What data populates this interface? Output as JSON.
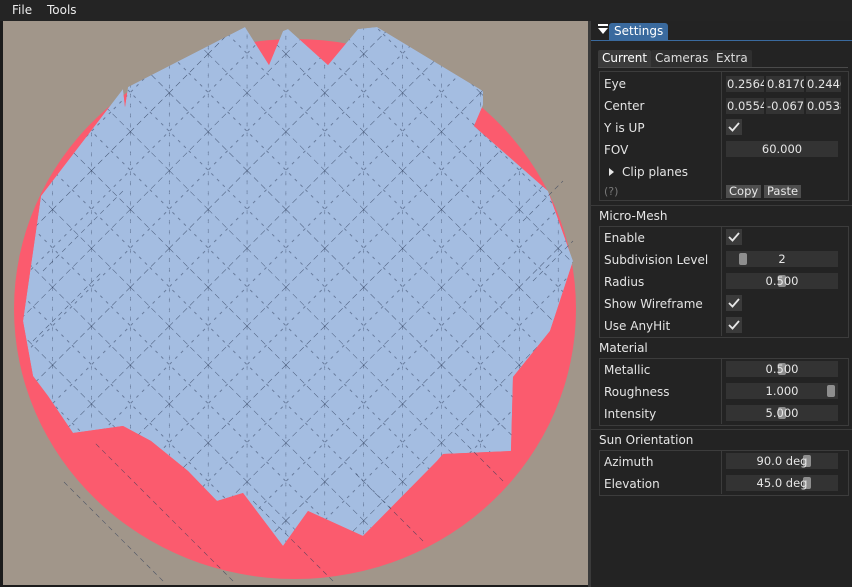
{
  "menu": {
    "file": "File",
    "tools": "Tools"
  },
  "panel": {
    "title": "Settings",
    "tabs": [
      "Current",
      "Cameras",
      "Extra"
    ],
    "active_tab": "Current"
  },
  "camera": {
    "eye_label": "Eye",
    "eye": [
      "0.2564",
      "0.8170",
      "0.2446"
    ],
    "center_label": "Center",
    "center": [
      "0.0554",
      "-0.067",
      "0.0538"
    ],
    "y_up_label": "Y is UP",
    "y_up": true,
    "fov_label": "FOV",
    "fov": "60.000",
    "clip_label": "Clip planes",
    "help": "(?)",
    "copy": "Copy",
    "paste": "Paste"
  },
  "micromesh": {
    "header": "Micro-Mesh",
    "enable_label": "Enable",
    "enable": true,
    "subdiv_label": "Subdivision Level",
    "subdiv": "2",
    "subdiv_level": 0.1,
    "radius_label": "Radius",
    "radius": "0.500",
    "radius_level": 0.5,
    "wire_label": "Show Wireframe",
    "wire": true,
    "anyhit_label": "Use AnyHit",
    "anyhit": true
  },
  "material": {
    "header": "Material",
    "metallic_label": "Metallic",
    "metallic": "0.500",
    "metallic_level": 0.5,
    "roughness_label": "Roughness",
    "roughness": "1.000",
    "roughness_level": 1.0,
    "intensity_label": "Intensity",
    "intensity": "5.000",
    "intensity_level": 0.5
  },
  "sun": {
    "header": "Sun Orientation",
    "azimuth_label": "Azimuth",
    "azimuth": "90.0 deg",
    "azimuth_level": 0.75,
    "elevation_label": "Elevation",
    "elevation": "45.0 deg",
    "elevation_level": 0.75
  },
  "colors": {
    "viewport_bg": "#a1968a",
    "disk_red": "#fb5b6e",
    "mesh_blue": "#a4bde1",
    "accent": "#3a6a9e"
  }
}
